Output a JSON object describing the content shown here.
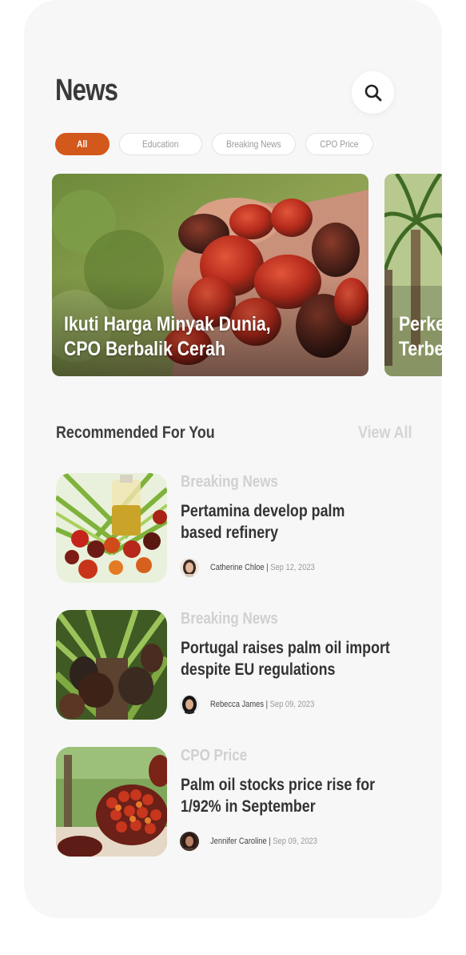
{
  "header": {
    "title": "News",
    "search_icon": "search-icon"
  },
  "categories": [
    {
      "label": "All",
      "active": true
    },
    {
      "label": "Education",
      "active": false
    },
    {
      "label": "Breaking News",
      "active": false
    },
    {
      "label": "CPO Price",
      "active": false
    }
  ],
  "featured": [
    {
      "title": "Ikuti Harga Minyak Dunia,\nCPO Berbalik Cerah"
    },
    {
      "title": "Perke\nTerbe"
    }
  ],
  "recommended": {
    "title": "Recommended For You",
    "view_all": "View All",
    "items": [
      {
        "category": "Breaking News",
        "headline": "Pertamina develop palm\nbased refinery",
        "author": "Catherine Chloe",
        "date": "Sep 12, 2023"
      },
      {
        "category": "Breaking News",
        "headline": "Portugal raises palm oil import\ndespite EU regulations",
        "author": "Rebecca James",
        "date": "Sep 09, 2023"
      },
      {
        "category": "CPO Price",
        "headline": "Palm oil stocks price rise for\n1/92% in September",
        "author": "Jennifer Caroline",
        "date": "Sep 09, 2023"
      }
    ]
  },
  "colors": {
    "accent": "#d2581c",
    "background": "#f7f7f7",
    "muted": "#d0d0d0"
  }
}
